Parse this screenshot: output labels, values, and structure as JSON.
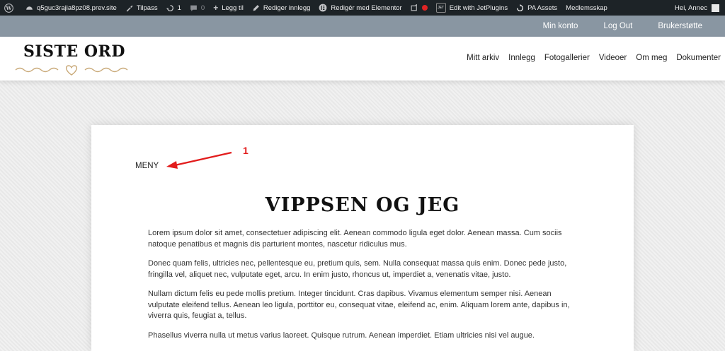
{
  "adminbar": {
    "site": "q5guc3rajia8pz08.prev.site",
    "customize": "Tilpass",
    "updates_count": "1",
    "comments_count": "0",
    "new": "Legg til",
    "edit_post": "Rediger innlegg",
    "elementor": "Redigér med Elementor",
    "jetplugins": "Edit with JetPlugins",
    "pa_assets": "PA Assets",
    "membership": "Medlemsskap",
    "greeting": "Hei, Annec"
  },
  "topbar": {
    "links": [
      "Min konto",
      "Log Out",
      "Brukerstøtte"
    ]
  },
  "header": {
    "logo": "SISTE ORD",
    "nav": [
      "Mitt arkiv",
      "Innlegg",
      "Fotogallerier",
      "Videoer",
      "Om meg",
      "Dokumenter"
    ]
  },
  "content": {
    "menu_label": "MENY",
    "annotation": "1",
    "title": "VIPPSEN OG JEG",
    "paragraphs": [
      "Lorem ipsum dolor sit amet, consectetuer adipiscing elit. Aenean commodo ligula eget dolor. Aenean massa. Cum sociis natoque penatibus et magnis dis parturient montes, nascetur ridiculus mus.",
      "Donec quam felis, ultricies nec, pellentesque eu, pretium quis, sem. Nulla consequat massa quis enim. Donec pede justo, fringilla vel, aliquet nec, vulputate eget, arcu. In enim justo, rhoncus ut, imperdiet a, venenatis vitae, justo.",
      "Nullam dictum felis eu pede mollis pretium. Integer tincidunt. Cras dapibus. Vivamus elementum semper nisi. Aenean vulputate eleifend tellus. Aenean leo ligula, porttitor eu, consequat vitae, eleifend ac, enim. Aliquam lorem ante, dapibus in, viverra quis, feugiat a, tellus.",
      "Phasellus viverra nulla ut metus varius laoreet. Quisque rutrum. Aenean imperdiet. Etiam ultricies nisi vel augue."
    ]
  },
  "colors": {
    "adminbar_bg": "#1d2327",
    "topbar_bg": "#8996a2",
    "annotation": "#e21c1c",
    "logo_deco": "#c9a978"
  }
}
